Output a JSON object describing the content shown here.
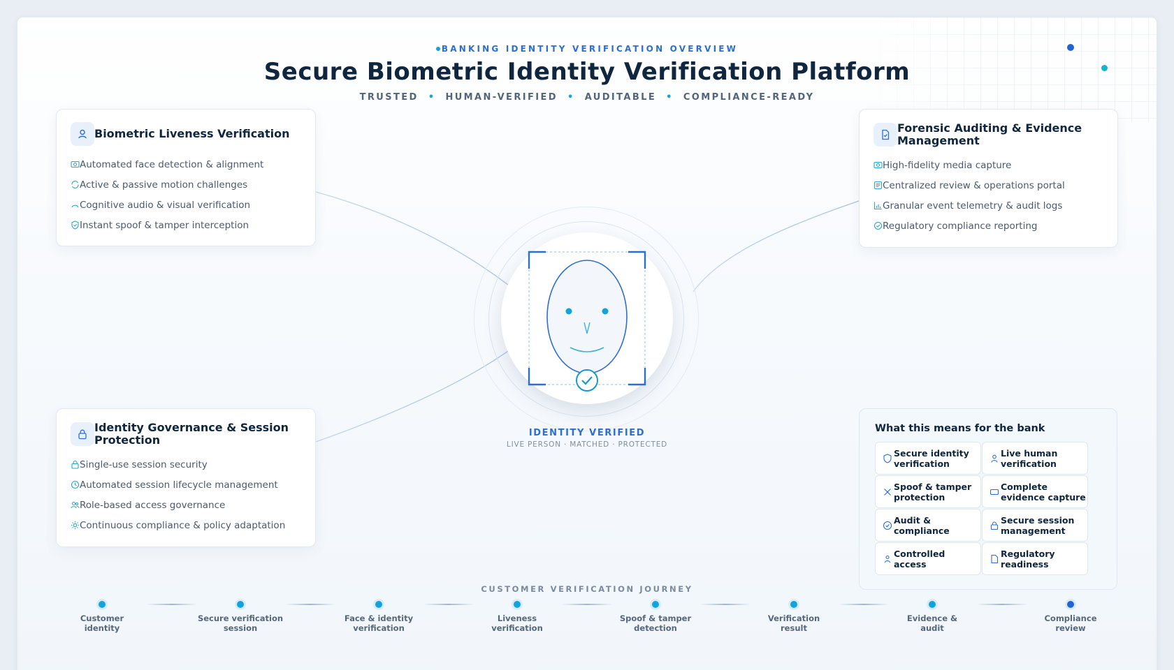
{
  "header": {
    "eyebrow": "BANKING IDENTITY VERIFICATION OVERVIEW",
    "title": "Secure Biometric Identity Verification Platform",
    "tags": [
      "TRUSTED",
      "HUMAN-VERIFIED",
      "AUDITABLE",
      "COMPLIANCE-READY"
    ]
  },
  "cards": {
    "liveness": {
      "title": "Biometric Liveness Verification",
      "icon": "user-icon",
      "items": [
        {
          "icon": "camera-icon",
          "label": "Automated face detection & alignment"
        },
        {
          "icon": "refresh-icon",
          "label": "Active & passive motion challenges"
        },
        {
          "icon": "arc-icon",
          "label": "Cognitive audio & visual verification"
        },
        {
          "icon": "shield-check-icon",
          "label": "Instant spoof & tamper interception"
        }
      ]
    },
    "forensic": {
      "title": "Forensic Auditing & Evidence Management",
      "icon": "document-check-icon",
      "items": [
        {
          "icon": "camera-icon",
          "label": "High-fidelity media capture"
        },
        {
          "icon": "list-icon",
          "label": "Centralized review & operations portal"
        },
        {
          "icon": "bar-chart-icon",
          "label": "Granular event telemetry & audit logs"
        },
        {
          "icon": "check-circle-icon",
          "label": "Regulatory compliance reporting"
        }
      ]
    },
    "governance": {
      "title": "Identity Governance & Session Protection",
      "icon": "lock-icon",
      "items": [
        {
          "icon": "lock-icon",
          "label": "Single-use session security"
        },
        {
          "icon": "clock-icon",
          "label": "Automated session lifecycle management"
        },
        {
          "icon": "users-icon",
          "label": "Role-based access governance"
        },
        {
          "icon": "sun-icon",
          "label": "Continuous compliance & policy adaptation"
        }
      ]
    }
  },
  "center": {
    "status": "IDENTITY VERIFIED",
    "substatus": "LIVE PERSON · MATCHED · PROTECTED"
  },
  "bank": {
    "title": "What this means for the bank",
    "items": [
      {
        "icon": "shield-icon",
        "label": "Secure identity verification"
      },
      {
        "icon": "person-icon",
        "label": "Live human verification"
      },
      {
        "icon": "x-icon",
        "label": "Spoof & tamper protection"
      },
      {
        "icon": "rectangle-icon",
        "label": "Complete evidence capture"
      },
      {
        "icon": "check-circle-icon",
        "label": "Audit & compliance"
      },
      {
        "icon": "lock-icon",
        "label": "Secure session management"
      },
      {
        "icon": "person-icon",
        "label": "Controlled access"
      },
      {
        "icon": "document-icon",
        "label": "Regulatory readiness"
      }
    ]
  },
  "journey": {
    "title": "CUSTOMER VERIFICATION JOURNEY",
    "steps": [
      "Customer identity",
      "Secure verification session",
      "Face & identity verification",
      "Liveness verification",
      "Spoof & tamper detection",
      "Verification result",
      "Evidence & audit",
      "Compliance review"
    ]
  },
  "colors": {
    "accent": "#2c6fd1",
    "teal": "#13a3dc",
    "title": "#10263f",
    "muted": "#53657a"
  }
}
